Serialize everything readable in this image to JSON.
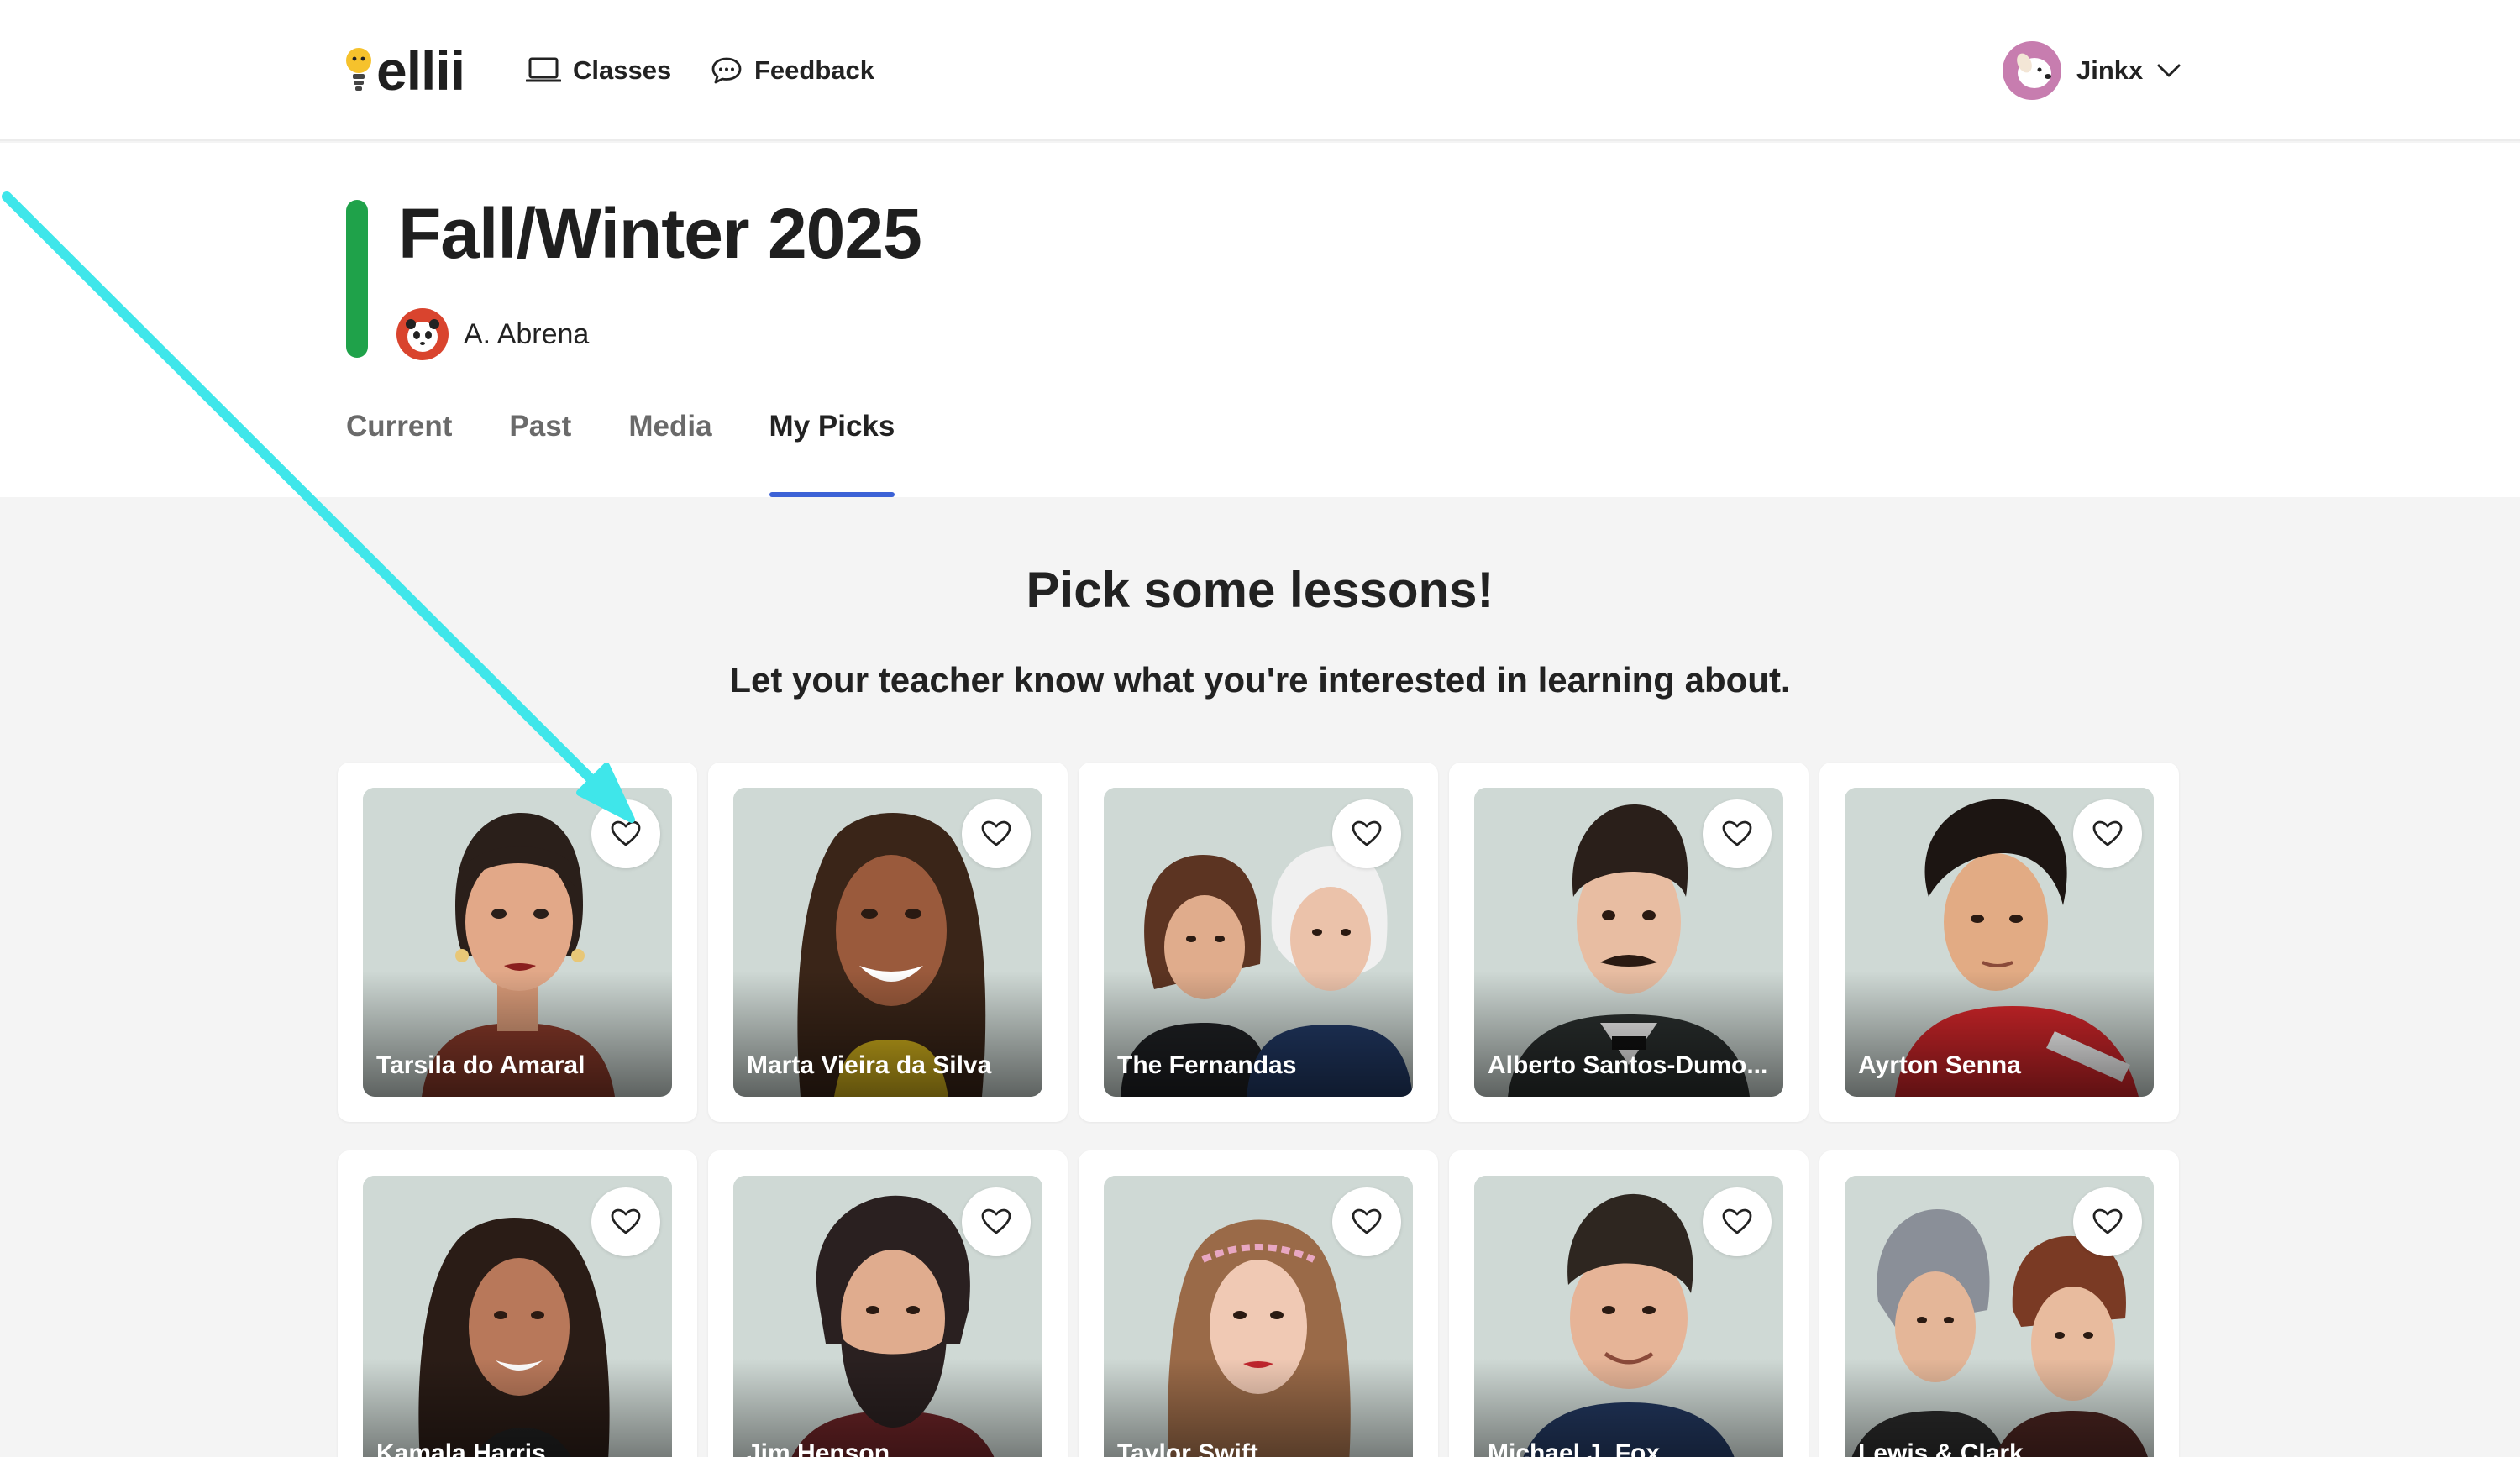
{
  "header": {
    "logo_text": "ellii",
    "nav": [
      {
        "label": "Classes",
        "icon": "laptop-icon"
      },
      {
        "label": "Feedback",
        "icon": "speech-bubble-icon"
      }
    ],
    "user": {
      "name": "Jinkx"
    }
  },
  "class": {
    "title": "Fall/Winter 2025",
    "teacher": "A. Abrena",
    "accent_color": "#1fa24a",
    "tabs": [
      {
        "label": "Current",
        "active": false
      },
      {
        "label": "Past",
        "active": false
      },
      {
        "label": "Media",
        "active": false
      },
      {
        "label": "My Picks",
        "active": true
      }
    ]
  },
  "main": {
    "heading": "Pick some lessons!",
    "subheading": "Let your teacher know what you're interested in learning about.",
    "lessons": [
      {
        "name": "Tarsila do Amaral"
      },
      {
        "name": "Marta Vieira da Silva"
      },
      {
        "name": "The Fernandas"
      },
      {
        "name": "Alberto Santos-Dumo..."
      },
      {
        "name": "Ayrton Senna"
      },
      {
        "name": "Kamala Harris"
      },
      {
        "name": "Jim Henson"
      },
      {
        "name": "Taylor Swift"
      },
      {
        "name": "Michael J. Fox"
      },
      {
        "name": "Lewis & Clark"
      }
    ]
  },
  "colors": {
    "tab_underline": "#3c62d6",
    "annotation_arrow": "#3fe6ea"
  }
}
